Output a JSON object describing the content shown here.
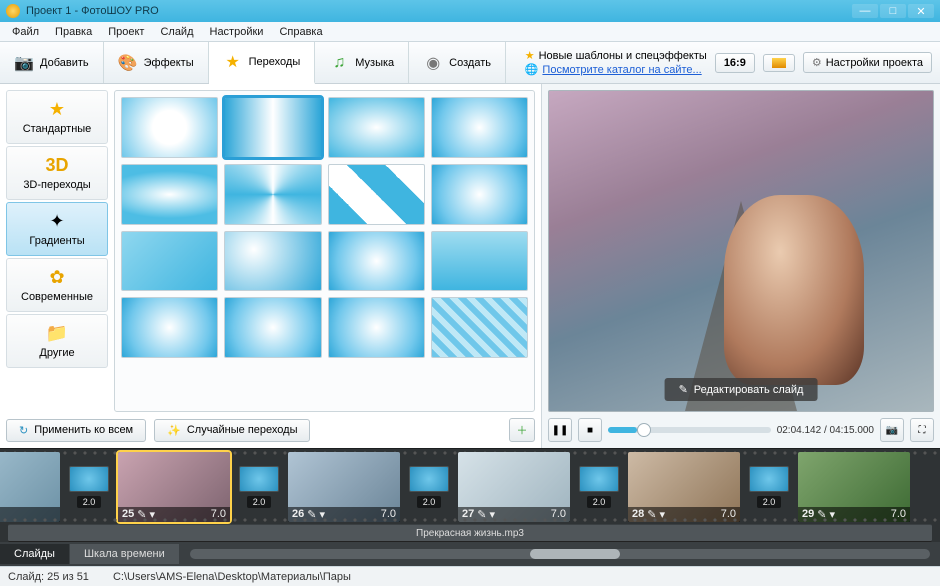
{
  "window": {
    "title": "Проект 1 - ФотоШОУ PRO"
  },
  "menu": [
    "Файл",
    "Правка",
    "Проект",
    "Слайд",
    "Настройки",
    "Справка"
  ],
  "tabs": {
    "add": "Добавить",
    "effects": "Эффекты",
    "transitions": "Переходы",
    "music": "Музыка",
    "create": "Создать"
  },
  "topinfo": {
    "line1": "Новые шаблоны и спецэффекты",
    "line2": "Посмотрите каталог на сайте..."
  },
  "aspect": "16:9",
  "settings_btn": "Настройки проекта",
  "categories": {
    "standard": "Стандартные",
    "threed": "3D-переходы",
    "gradients": "Градиенты",
    "modern": "Современные",
    "other": "Другие"
  },
  "leftfoot": {
    "apply_all": "Применить ко всем",
    "random": "Случайные переходы"
  },
  "preview": {
    "edit": "Редактировать слайд"
  },
  "player": {
    "time": "02:04.142 / 04:15.000"
  },
  "timeline": {
    "slides": [
      {
        "num": "25",
        "dur": "7.0"
      },
      {
        "num": "26",
        "dur": "7.0"
      },
      {
        "num": "27",
        "dur": "7.0"
      },
      {
        "num": "28",
        "dur": "7.0"
      },
      {
        "num": "29",
        "dur": "7.0"
      }
    ],
    "trans_dur": "2.0",
    "audio": "Прекрасная жизнь.mp3"
  },
  "bottom_tabs": {
    "slides": "Слайды",
    "timeline": "Шкала времени"
  },
  "status": {
    "slide": "Слайд: 25 из 51",
    "path": "C:\\Users\\AMS-Elena\\Desktop\\Материалы\\Пары"
  }
}
